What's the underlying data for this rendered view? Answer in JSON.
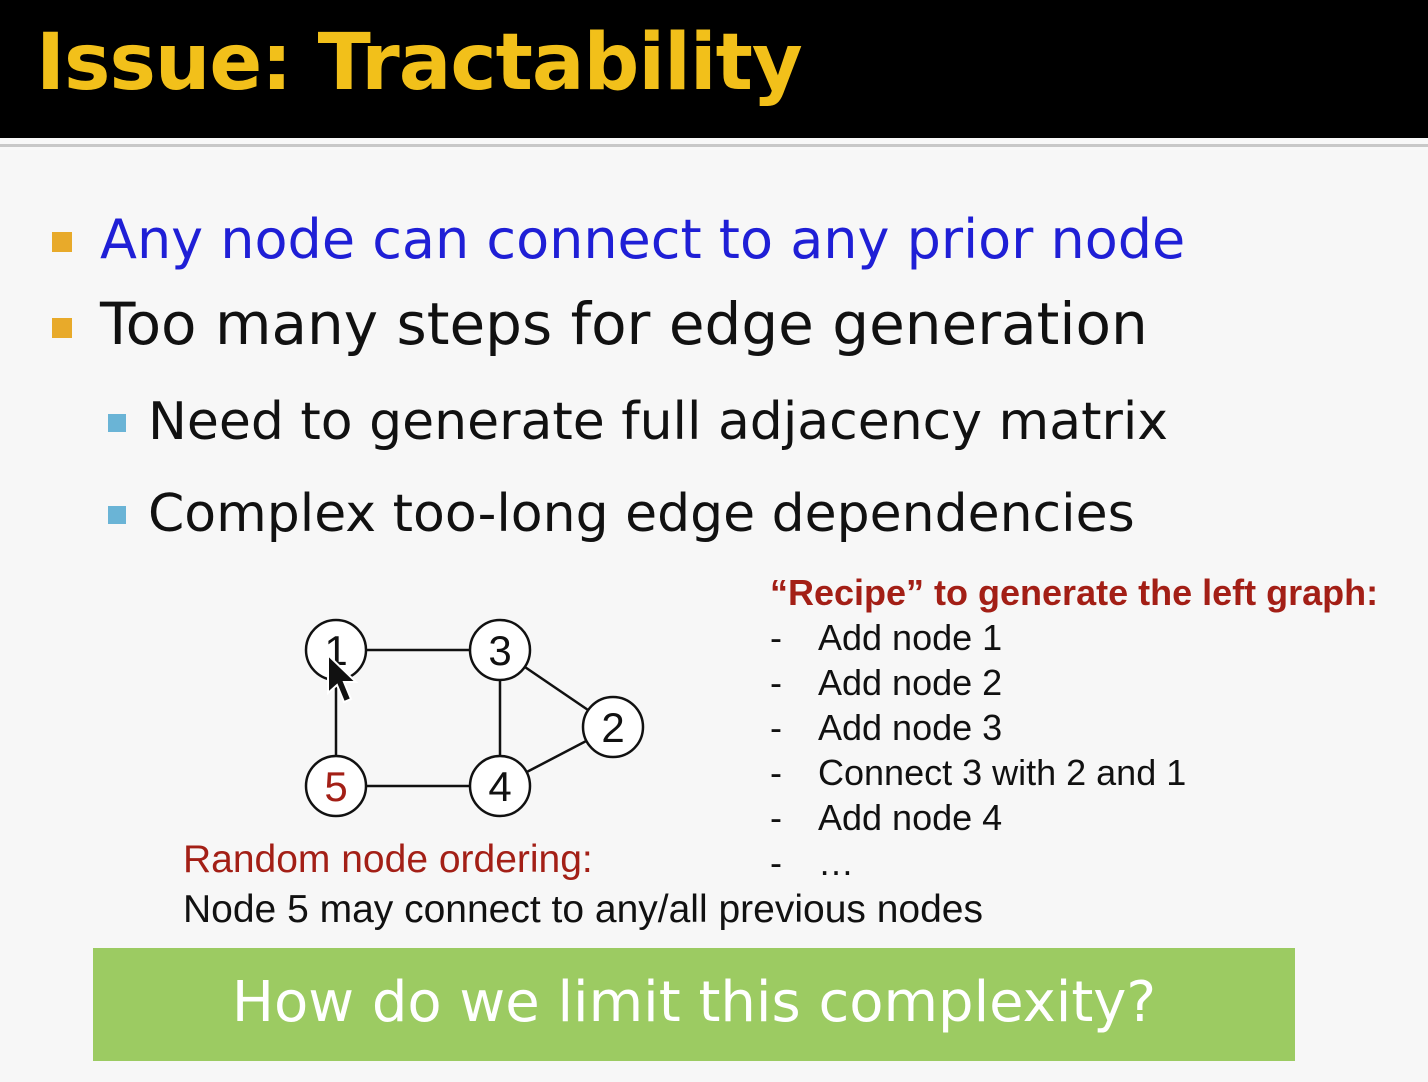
{
  "slide": {
    "title": "Issue: Tractability",
    "bullets": [
      "Any node can connect to any prior node",
      "Too many steps for edge generation"
    ],
    "sub_bullets": [
      "Need to generate full adjacency matrix",
      "Complex too-long edge dependencies"
    ],
    "graph": {
      "nodes": [
        "1",
        "3",
        "2",
        "5",
        "4"
      ],
      "edges": [
        [
          "1",
          "3"
        ],
        [
          "3",
          "2"
        ],
        [
          "3",
          "4"
        ],
        [
          "1",
          "5"
        ],
        [
          "5",
          "4"
        ],
        [
          "4",
          "2"
        ]
      ],
      "highlight_node": "5",
      "highlight_color": "#a31f16"
    },
    "recipe": {
      "title": "“Recipe” to generate the left graph:",
      "steps": [
        "Add node 1",
        "Add node 2",
        "Add node 3",
        "Connect 3 with 2 and 1",
        "Add node 4",
        "…"
      ]
    },
    "ordering": {
      "title": "Random node ordering:",
      "text": "Node 5 may connect to any/all previous nodes"
    },
    "question": "How do we limit this complexity?",
    "colors": {
      "title": "#f2c01a",
      "title_bar": "#000000",
      "bullet_square": "#e8aa2a",
      "sub_bullet_square": "#6ab4d6",
      "highlight_text": "#1f1fd6",
      "recipe_red": "#a31f16",
      "question_box": "#9ccb62"
    }
  }
}
